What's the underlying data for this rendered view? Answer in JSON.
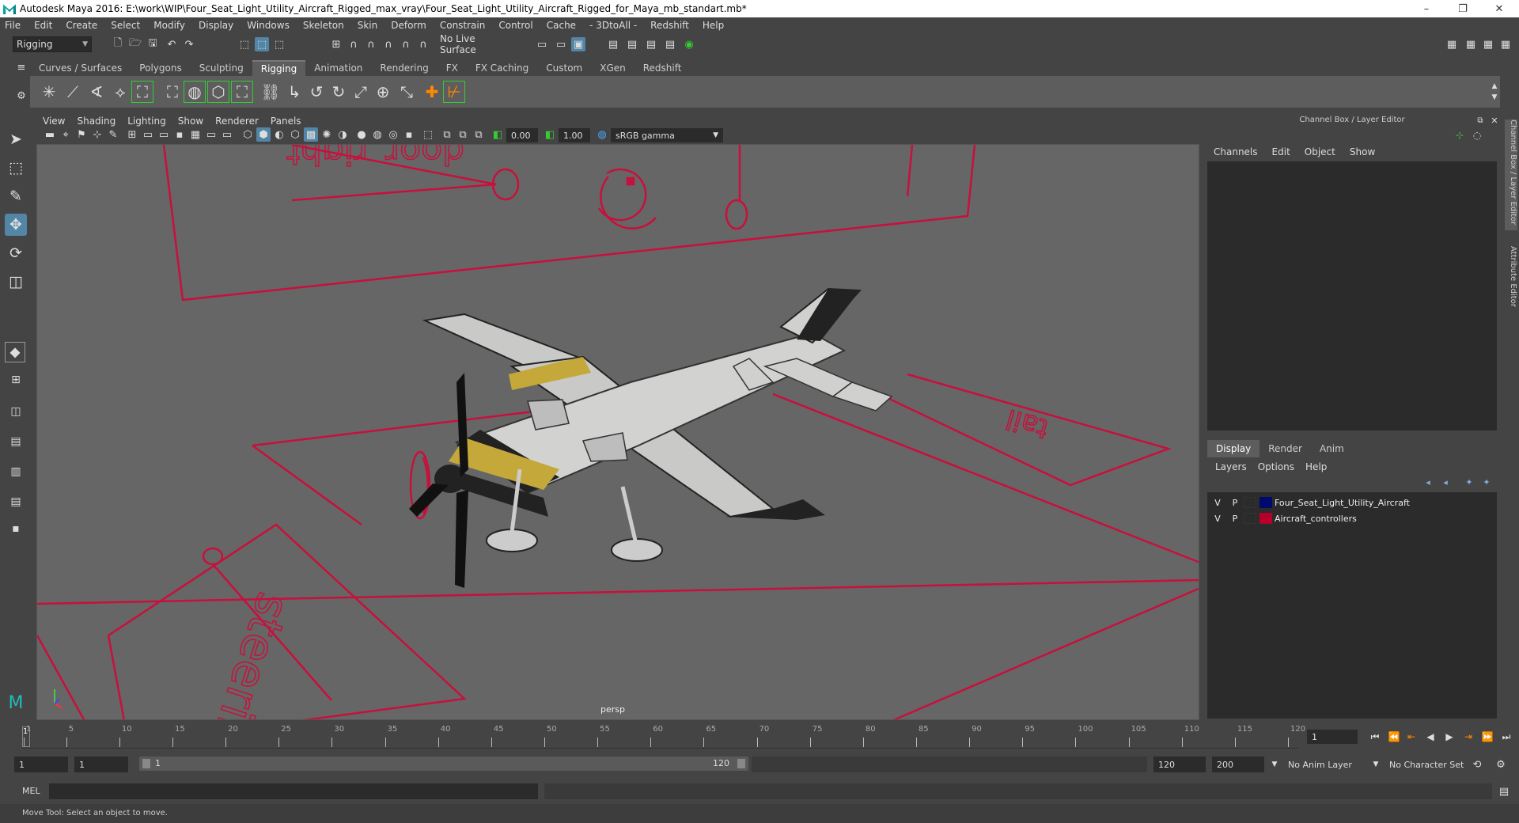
{
  "window": {
    "title": "Autodesk Maya 2016: E:\\work\\WIP\\Four_Seat_Light_Utility_Aircraft_Rigged_max_vray\\Four_Seat_Light_Utility_Aircraft_Rigged_for_Maya_mb_standart.mb*",
    "controls": [
      "–",
      "❐",
      "✕"
    ]
  },
  "menubar": [
    "File",
    "Edit",
    "Create",
    "Select",
    "Modify",
    "Display",
    "Windows",
    "Skeleton",
    "Skin",
    "Deform",
    "Constrain",
    "Control",
    "Cache",
    "- 3DtoAll -",
    "Redshift",
    "Help"
  ],
  "statusline": {
    "menu_set": "Rigging",
    "live_surface": "No Live Surface"
  },
  "shelf": {
    "tabs": [
      "Curves / Surfaces",
      "Polygons",
      "Sculpting",
      "Rigging",
      "Animation",
      "Rendering",
      "FX",
      "FX Caching",
      "Custom",
      "XGen",
      "Redshift"
    ],
    "active_tab": "Rigging"
  },
  "viewport": {
    "menu": [
      "View",
      "Shading",
      "Lighting",
      "Show",
      "Renderer",
      "Panels"
    ],
    "exposure": "0.00",
    "gamma": "1.00",
    "color_space": "sRGB gamma",
    "camera_label": "persp",
    "scene_text": [
      "door_right",
      "tail",
      "steering"
    ]
  },
  "channel_box": {
    "header": "Channel Box / Layer Editor",
    "menu": [
      "Channels",
      "Edit",
      "Object",
      "Show"
    ]
  },
  "layer_editor": {
    "tabs": [
      "Display",
      "Render",
      "Anim"
    ],
    "active_tab": "Display",
    "menu": [
      "Layers",
      "Options",
      "Help"
    ],
    "layers": [
      {
        "v": "V",
        "p": "P",
        "name": "Four_Seat_Light_Utility_Aircraft",
        "color": "#000a6e"
      },
      {
        "v": "V",
        "p": "P",
        "name": "Aircraft_controllers",
        "color": "#b5002a"
      }
    ]
  },
  "side_tabs": [
    "Channel Box / Layer Editor",
    "Attribute Editor"
  ],
  "timeline": {
    "labels": [
      "1",
      "5",
      "10",
      "15",
      "20",
      "25",
      "30",
      "35",
      "40",
      "45",
      "50",
      "55",
      "60",
      "65",
      "70",
      "75",
      "80",
      "85",
      "90",
      "95",
      "100",
      "105",
      "110",
      "115",
      "120"
    ],
    "current_frame": "1",
    "current_frame_field": "1"
  },
  "range": {
    "start": "1",
    "inner_start": "1",
    "slider_start": "1",
    "slider_end": "120",
    "end": "120",
    "anim_end": "200",
    "anim_layer": "No Anim Layer",
    "character_set": "No Character Set"
  },
  "command_line": {
    "label": "MEL"
  },
  "help_line": "Move Tool: Select an object to move.",
  "colors": {
    "controller_red": "#c8103c",
    "active_blue": "#5285a6"
  }
}
